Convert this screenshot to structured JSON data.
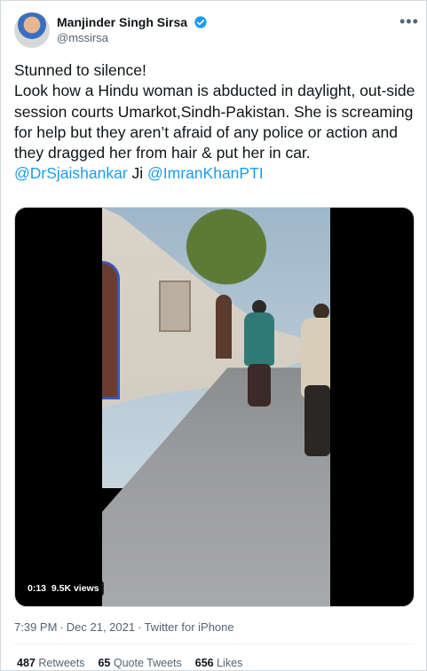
{
  "author": {
    "name": "Manjinder Singh Sirsa",
    "handle": "@mssirsa",
    "verified_icon": "verified-badge-icon"
  },
  "tweet": {
    "line1": "Stunned to silence!",
    "line2": "Look how a Hindu woman is abducted in daylight, out-side session courts Umarkot,Sindh-Pakistan. She is screaming for help but they aren’t afraid of any police or action and they dragged her from hair & put her in car.",
    "mention1": "@DrSjaishankar",
    "connector": " Ji ",
    "mention2": "@ImranKhanPTI"
  },
  "video": {
    "duration": "0:13",
    "views": "9.5K views"
  },
  "meta": {
    "time": "7:39 PM",
    "date": "Dec 21, 2021",
    "source": "Twitter for iPhone",
    "separator": "·"
  },
  "engagement": {
    "retweets_count": "487",
    "retweets_label": "Retweets",
    "quotes_count": "65",
    "quotes_label": "Quote Tweets",
    "likes_count": "656",
    "likes_label": "Likes"
  },
  "colors": {
    "accent": "#1d9bf0",
    "secondary_text": "#536471"
  },
  "more_icon": "more-options-icon"
}
